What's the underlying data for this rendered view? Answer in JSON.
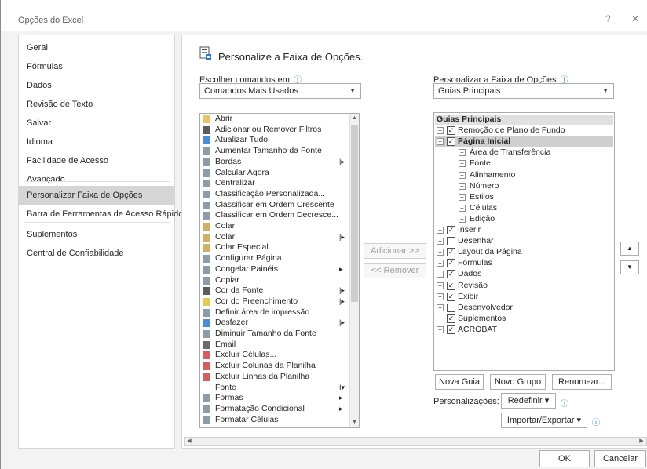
{
  "window": {
    "title": "Opções do Excel",
    "help": "?",
    "close": "✕"
  },
  "nav": {
    "items": [
      {
        "label": "Geral"
      },
      {
        "label": "Fórmulas"
      },
      {
        "label": "Dados"
      },
      {
        "label": "Revisão de Texto"
      },
      {
        "label": "Salvar"
      },
      {
        "label": "Idioma"
      },
      {
        "label": "Facilidade de Acesso"
      },
      {
        "label": "Avançado"
      },
      {
        "label": "Personalizar Faixa de Opções",
        "selected": true
      },
      {
        "label": "Barra de Ferramentas de Acesso Rápido"
      },
      {
        "label": "Suplementos"
      },
      {
        "label": "Central de Confiabilidade"
      }
    ]
  },
  "main": {
    "heading": "Personalize a Faixa de Opções.",
    "choose_label": "Escolher comandos em:",
    "choose_value": "Comandos Mais Usados",
    "customize_label": "Personalizar a Faixa de Opções:",
    "customize_value": "Guias Principais",
    "commands": [
      {
        "label": "Abrir",
        "icon": "folder-icon",
        "sub": ""
      },
      {
        "label": "Adicionar ou Remover Filtros",
        "icon": "filter-icon",
        "sub": ""
      },
      {
        "label": "Atualizar Tudo",
        "icon": "refresh-icon",
        "sub": ""
      },
      {
        "label": "Aumentar Tamanho da Fonte",
        "icon": "font-grow-icon",
        "sub": ""
      },
      {
        "label": "Bordas",
        "icon": "borders-icon",
        "sub": "|▸"
      },
      {
        "label": "Calcular Agora",
        "icon": "calculator-icon",
        "sub": ""
      },
      {
        "label": "Centralizar",
        "icon": "align-center-icon",
        "sub": ""
      },
      {
        "label": "Classificação Personalizada...",
        "icon": "sort-custom-icon",
        "sub": ""
      },
      {
        "label": "Classificar em Ordem Crescente",
        "icon": "sort-asc-icon",
        "sub": ""
      },
      {
        "label": "Classificar em Ordem Decresce...",
        "icon": "sort-desc-icon",
        "sub": ""
      },
      {
        "label": "Colar",
        "icon": "paste-icon",
        "sub": ""
      },
      {
        "label": "Colar",
        "icon": "paste-icon",
        "sub": "|▸"
      },
      {
        "label": "Colar Especial...",
        "icon": "paste-special-icon",
        "sub": ""
      },
      {
        "label": "Configurar Página",
        "icon": "page-setup-icon",
        "sub": ""
      },
      {
        "label": "Congelar Painéis",
        "icon": "freeze-panes-icon",
        "sub": "▸"
      },
      {
        "label": "Copiar",
        "icon": "copy-icon",
        "sub": ""
      },
      {
        "label": "Cor da Fonte",
        "icon": "font-color-icon",
        "sub": "|▸"
      },
      {
        "label": "Cor do Preenchimento",
        "icon": "fill-color-icon",
        "sub": "|▸"
      },
      {
        "label": "Definir área de impressão",
        "icon": "print-area-icon",
        "sub": ""
      },
      {
        "label": "Desfazer",
        "icon": "undo-icon",
        "sub": "|▸"
      },
      {
        "label": "Diminuir Tamanho da Fonte",
        "icon": "font-shrink-icon",
        "sub": ""
      },
      {
        "label": "Email",
        "icon": "email-icon",
        "sub": ""
      },
      {
        "label": "Excluir Células...",
        "icon": "delete-cells-icon",
        "sub": ""
      },
      {
        "label": "Excluir Colunas da Planilha",
        "icon": "delete-columns-icon",
        "sub": ""
      },
      {
        "label": "Excluir Linhas da Planilha",
        "icon": "delete-rows-icon",
        "sub": ""
      },
      {
        "label": "Fonte",
        "icon": "",
        "sub": "I▾"
      },
      {
        "label": "Formas",
        "icon": "shapes-icon",
        "sub": "▸"
      },
      {
        "label": "Formatação Condicional",
        "icon": "conditional-format-icon",
        "sub": "▸"
      },
      {
        "label": "Formatar Células",
        "icon": "format-cells-icon",
        "sub": ""
      }
    ],
    "add_button": "Adicionar >>",
    "remove_button": "<< Remover",
    "tree": [
      {
        "label": "Guias Principais",
        "level": 0,
        "header": true
      },
      {
        "label": "Remoção de Plano de Fundo",
        "level": 0,
        "expander": "+",
        "checked": true
      },
      {
        "label": "Página Inicial",
        "level": 0,
        "expander": "−",
        "checked": true,
        "selected": true
      },
      {
        "label": "Área de Transferência",
        "level": 1,
        "expander": "+"
      },
      {
        "label": "Fonte",
        "level": 1,
        "expander": "+"
      },
      {
        "label": "Alinhamento",
        "level": 1,
        "expander": "+"
      },
      {
        "label": "Número",
        "level": 1,
        "expander": "+"
      },
      {
        "label": "Estilos",
        "level": 1,
        "expander": "+"
      },
      {
        "label": "Células",
        "level": 1,
        "expander": "+"
      },
      {
        "label": "Edição",
        "level": 1,
        "expander": "+"
      },
      {
        "label": "Inserir",
        "level": 0,
        "expander": "+",
        "checked": true
      },
      {
        "label": "Desenhar",
        "level": 0,
        "expander": "+",
        "checked": false
      },
      {
        "label": "Layout da Página",
        "level": 0,
        "expander": "+",
        "checked": true
      },
      {
        "label": "Fórmulas",
        "level": 0,
        "expander": "+",
        "checked": true
      },
      {
        "label": "Dados",
        "level": 0,
        "expander": "+",
        "checked": true
      },
      {
        "label": "Revisão",
        "level": 0,
        "expander": "+",
        "checked": true
      },
      {
        "label": "Exibir",
        "level": 0,
        "expander": "+",
        "checked": true
      },
      {
        "label": "Desenvolvedor",
        "level": 0,
        "expander": "+",
        "checked": false
      },
      {
        "label": "Suplementos",
        "level": 0,
        "expander": "",
        "checked": true
      },
      {
        "label": "ACROBAT",
        "level": 0,
        "expander": "+",
        "checked": true
      }
    ],
    "move_up": "▲",
    "move_down": "▼",
    "new_tab": "Nova Guia",
    "new_group": "Novo Grupo",
    "rename": "Renomear...",
    "customizations_label": "Personalizações:",
    "reset_button": "Redefinir ▾",
    "import_export_button": "Importar/Exportar ▾"
  },
  "footer": {
    "ok": "OK",
    "cancel": "Cancelar"
  },
  "colors": {
    "accent": "#2b79d2",
    "selected_nav": "#d5d5d5",
    "selected_tree": "#cfcfcf",
    "header_row": "#e0e0e0"
  }
}
